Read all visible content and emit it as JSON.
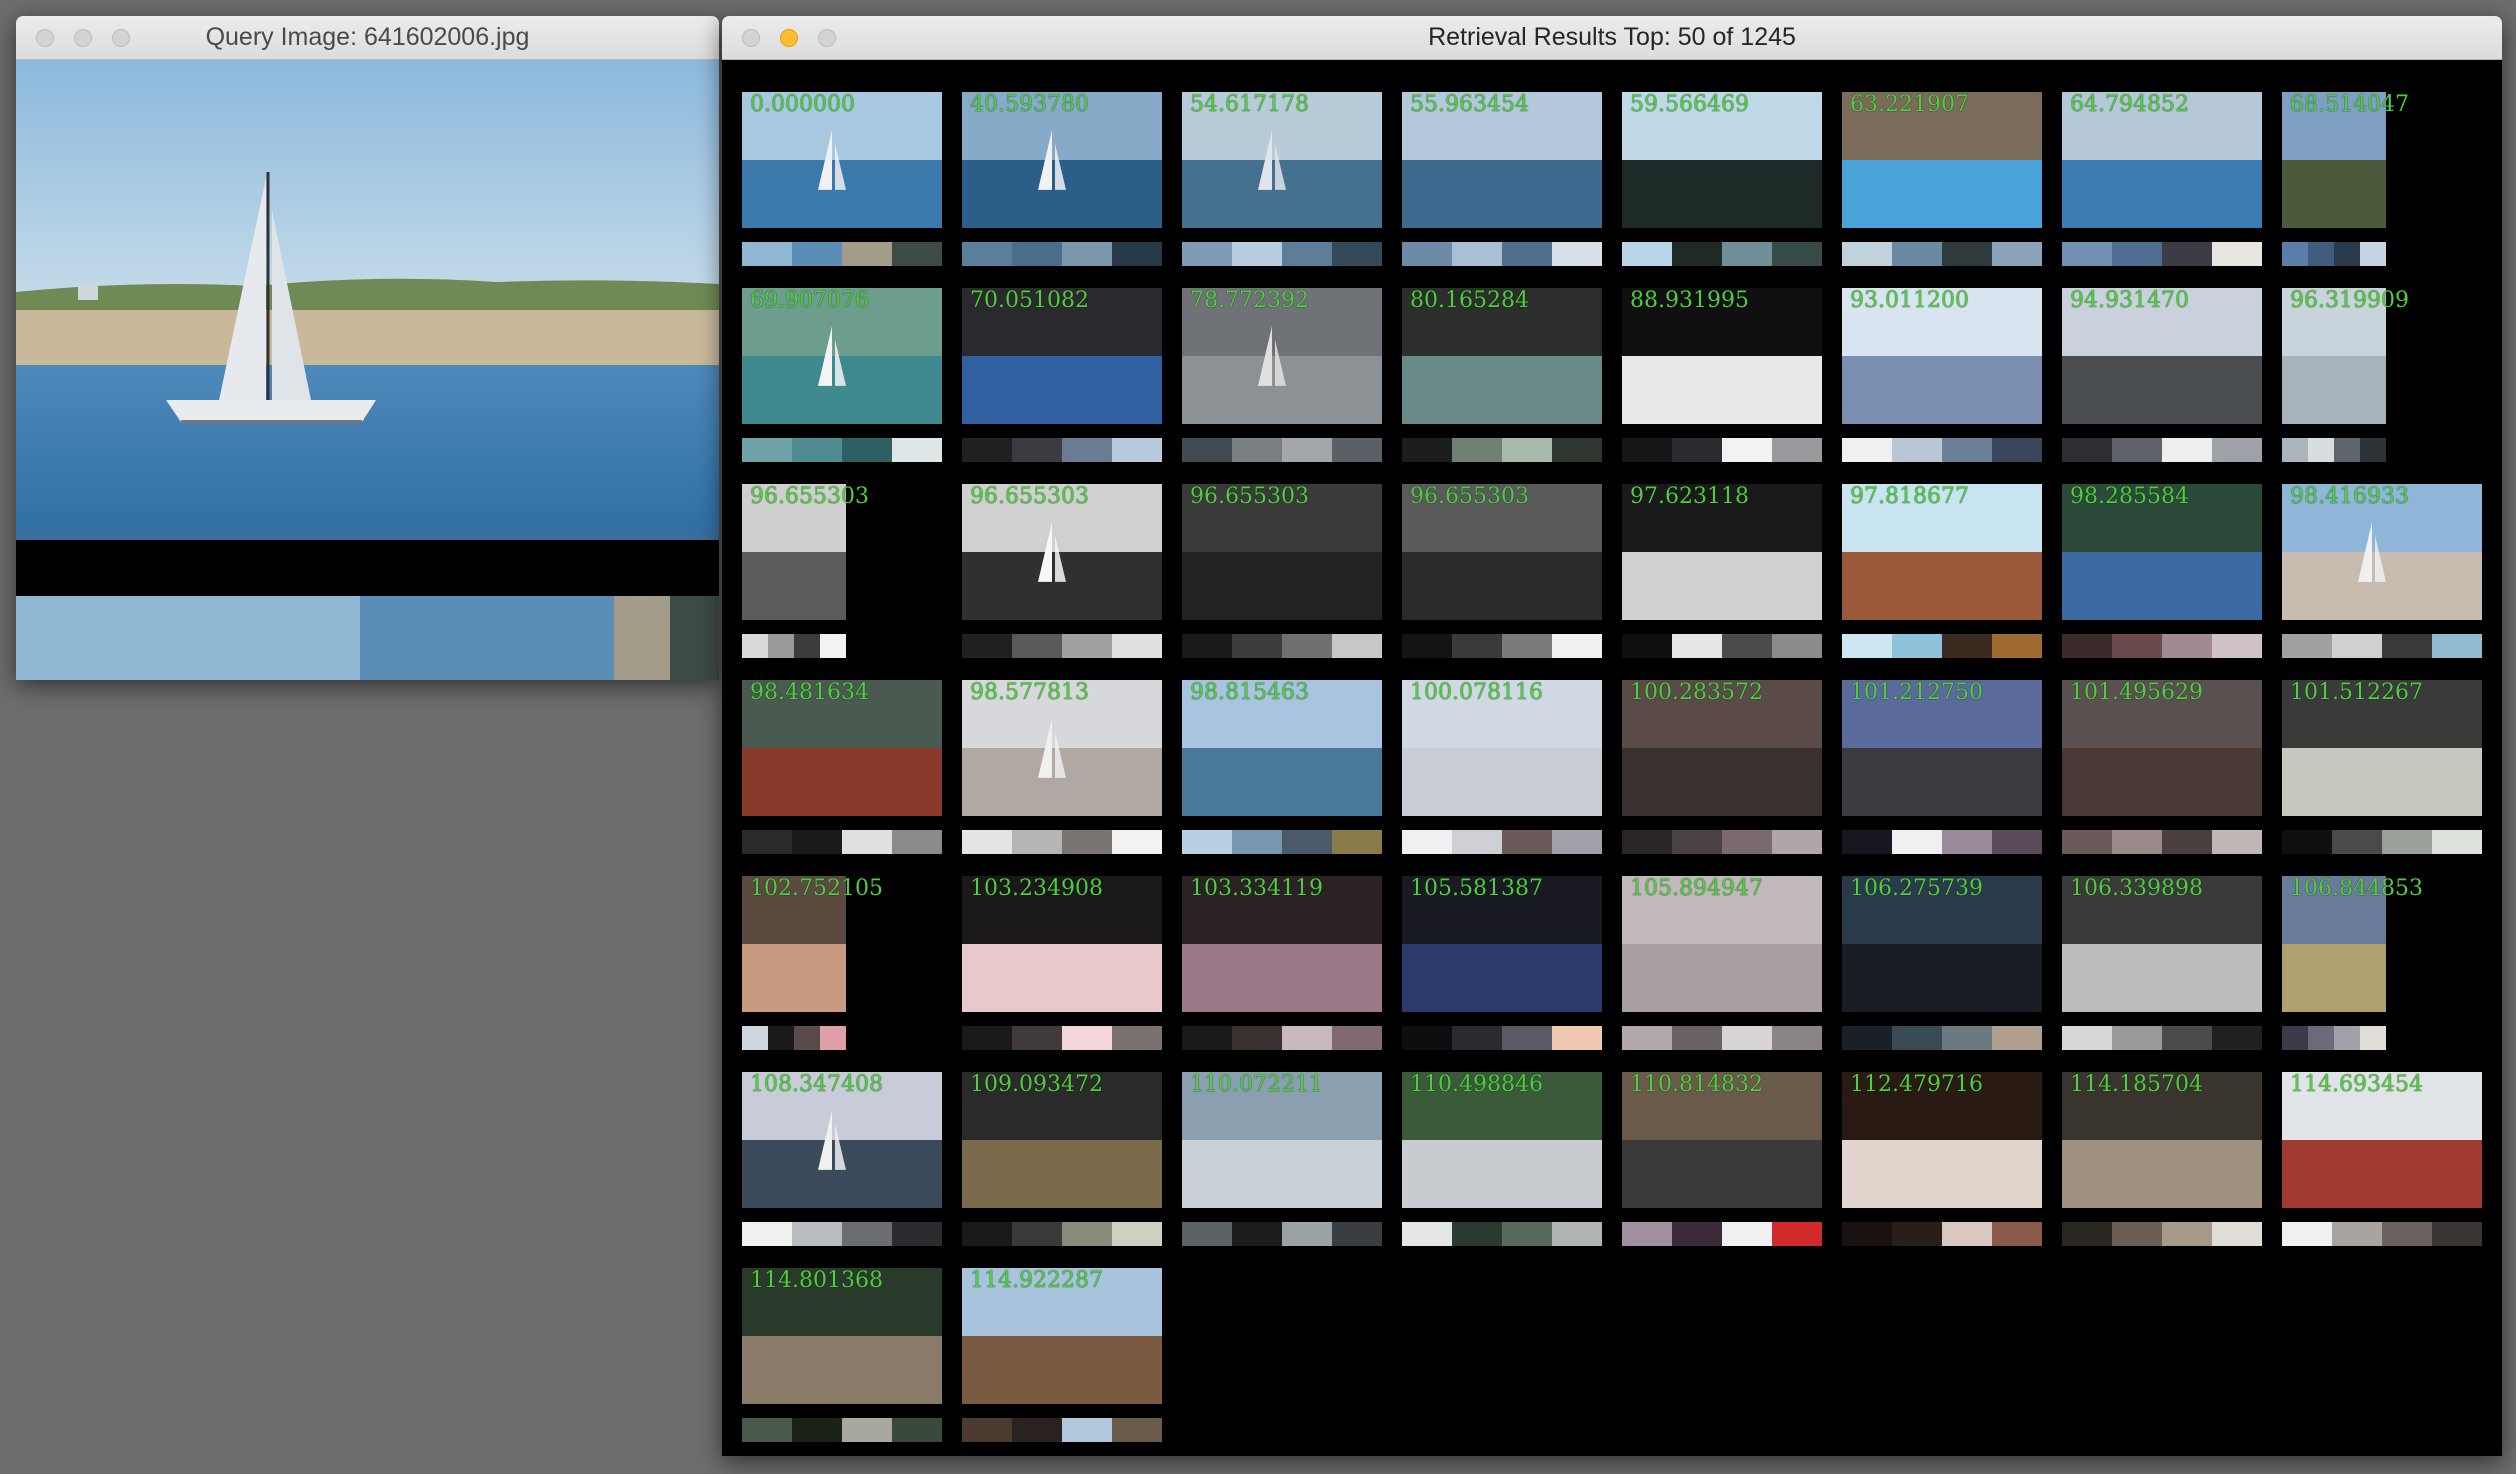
{
  "query_window": {
    "title": "Query Image: 641602006.jpg",
    "swatches": [
      [
        "#8fb6d3",
        49
      ],
      [
        "#5b8eb6",
        36
      ],
      [
        "#a39c88",
        8
      ],
      [
        "#3d4b45",
        7
      ]
    ]
  },
  "results_window": {
    "title": "Retrieval Results Top: 50 of 1245",
    "results": [
      {
        "score": "0.000000",
        "sw": [
          "#8fb6d3",
          "#5b8eb6",
          "#a39c88",
          "#3d4b45"
        ],
        "img": {
          "sky": "#a7c8e0",
          "ground": "#3c79ab",
          "sail": "#eef0f2"
        }
      },
      {
        "score": "40.593780",
        "sw": [
          "#5c7f9c",
          "#4a6d8a",
          "#7a96aa",
          "#273846"
        ],
        "img": {
          "sky": "#87aac8",
          "ground": "#2b5f8a",
          "sail": "#f2f2f2"
        }
      },
      {
        "score": "54.617178",
        "sw": [
          "#7e9cb5",
          "#b9cde0",
          "#5c7e99",
          "#34495a"
        ],
        "img": {
          "sky": "#b7cbd8",
          "ground": "#45708f",
          "sail": "#dfe5ea"
        }
      },
      {
        "score": "55.963454",
        "sw": [
          "#6d8aa6",
          "#a9c0d4",
          "#4f6f8c",
          "#d6e0e8"
        ],
        "img": {
          "sky": "#b3c9db",
          "ground": "#3e6a8f",
          "sail": null
        }
      },
      {
        "score": "59.566469",
        "sw": [
          "#b8d4e6",
          "#1f2a24",
          "#6f8f98",
          "#384b48"
        ],
        "img": {
          "sky": "#c1d8e8",
          "ground": "#1d2a28",
          "sail": null
        }
      },
      {
        "score": "63.221907",
        "sw": [
          "#c2d2dc",
          "#6a8aa3",
          "#2f3a3d",
          "#8aa3b8"
        ],
        "img": {
          "sky": "#7a6b5a",
          "ground": "#4aa3d8",
          "sail": null
        }
      },
      {
        "score": "64.794852",
        "sw": [
          "#6f8fb3",
          "#4d6d91",
          "#3c3c46",
          "#e8e4e0"
        ],
        "img": {
          "sky": "#b6c8d8",
          "ground": "#3b7cb4",
          "sail": null
        }
      },
      {
        "score": "68.514047",
        "sw": [
          "#5a7ea8",
          "#405d80",
          "#2a3a4c",
          "#c5d4e1"
        ],
        "img": {
          "sky": "#7f9fc2",
          "ground": "#4a5a3a",
          "sail": null
        }
      },
      {
        "score": "69.907076",
        "sw": [
          "#6fa3a8",
          "#4f8a90",
          "#2e5f63",
          "#dfe6e8"
        ],
        "img": {
          "sky": "#6d9d8c",
          "ground": "#3e8a8f",
          "sail": "#f4f4f4"
        }
      },
      {
        "score": "70.051082",
        "sw": [
          "#1e2022",
          "#3a3c42",
          "#6b7c92",
          "#b8cade"
        ],
        "img": {
          "sky": "#2a2a2e",
          "ground": "#3060a0",
          "sail": null
        }
      },
      {
        "score": "78.772392",
        "sw": [
          "#3f4a52",
          "#7a7f84",
          "#a3a7aa",
          "#5a6066"
        ],
        "img": {
          "sky": "#6f7377",
          "ground": "#8c9195",
          "sail": "#e0e0e0"
        }
      },
      {
        "score": "80.165284",
        "sw": [
          "#1c1e1c",
          "#6f7f72",
          "#a8b8ab",
          "#2f3630"
        ],
        "img": {
          "sky": "#2b2e2a",
          "ground": "#6a8a88",
          "sail": null
        }
      },
      {
        "score": "88.931995",
        "sw": [
          "#151618",
          "#2a2c30",
          "#f2f2f2",
          "#9a9a9e"
        ],
        "img": {
          "sky": "#101010",
          "ground": "#e8e8e8",
          "sail": null
        }
      },
      {
        "score": "93.011200",
        "sw": [
          "#f0f0f0",
          "#b9c6d4",
          "#6b7f96",
          "#39455a"
        ],
        "img": {
          "sky": "#d8e4f0",
          "ground": "#7a8fb0",
          "sail": null
        }
      },
      {
        "score": "94.931470",
        "sw": [
          "#2d2f33",
          "#5f6268",
          "#eeeeee",
          "#9ea2a8"
        ],
        "img": {
          "sky": "#c9d2dc",
          "ground": "#4a4d50",
          "sail": null
        }
      },
      {
        "score": "96.319909",
        "sw": [
          "#aab4bb",
          "#d7dde1",
          "#5d666c",
          "#2c3236"
        ],
        "img": {
          "sky": "#c8d3db",
          "ground": "#a7b3bb",
          "sail": null
        }
      },
      {
        "score": "96.655303",
        "sw": [
          "#d9d9d9",
          "#9a9a9a",
          "#3b3b3b",
          "#f2f2f2"
        ],
        "img": {
          "sky": "#cfcfcf",
          "ground": "#5b5b5b",
          "sail": null
        }
      },
      {
        "score": "96.655303",
        "sw": [
          "#202020",
          "#5a5a5a",
          "#a0a0a0",
          "#e0e0e0"
        ],
        "img": {
          "sky": "#d0d0d0",
          "ground": "#303030",
          "sail": "#f8f8f8"
        }
      },
      {
        "score": "96.655303",
        "sw": [
          "#1a1a1a",
          "#3d3d3d",
          "#707070",
          "#c8c8c8"
        ],
        "img": {
          "sky": "#3a3a3a",
          "ground": "#222222",
          "sail": null
        }
      },
      {
        "score": "96.655303",
        "sw": [
          "#141414",
          "#3a3a3a",
          "#7a7a7a",
          "#f0f0f0"
        ],
        "img": {
          "sky": "#5a5a5a",
          "ground": "#2a2a2a",
          "sail": null
        }
      },
      {
        "score": "97.623118",
        "sw": [
          "#101010",
          "#e6e6e6",
          "#4a4a4a",
          "#8a8a8a"
        ],
        "img": {
          "sky": "#1a1a1a",
          "ground": "#d0d0d0",
          "sail": null
        }
      },
      {
        "score": "97.818677",
        "sw": [
          "#cde6f2",
          "#8fc3dc",
          "#3a2a20",
          "#a06a30"
        ],
        "img": {
          "sky": "#c8e4f0",
          "ground": "#9a5a3a",
          "sail": null
        }
      },
      {
        "score": "98.285584",
        "sw": [
          "#3a2a2a",
          "#6a4a4a",
          "#a08a90",
          "#d0c0c8"
        ],
        "img": {
          "sky": "#2c4a3a",
          "ground": "#3a6aa0",
          "sail": null
        }
      },
      {
        "score": "98.416933",
        "sw": [
          "#a0a0a0",
          "#d0d0d0",
          "#3a3a3a",
          "#8fbad0"
        ],
        "img": {
          "sky": "#8fb6d8",
          "ground": "#c8bcb0",
          "sail": "#f0f0f0"
        }
      },
      {
        "score": "98.481634",
        "sw": [
          "#2a2a2a",
          "#1a1a1a",
          "#e0e0e0",
          "#8a8a8a"
        ],
        "img": {
          "sky": "#4a5a50",
          "ground": "#8a3a2a",
          "sail": null
        }
      },
      {
        "score": "98.577813",
        "sw": [
          "#e4e4e6",
          "#b6b4b4",
          "#7a7472",
          "#f2f2f2"
        ],
        "img": {
          "sky": "#d6d8dc",
          "ground": "#b0a8a2",
          "sail": "#f0f0f0"
        }
      },
      {
        "score": "98.815463",
        "sw": [
          "#b8d0e4",
          "#7896b0",
          "#4a5a6a",
          "#8a7a4a"
        ],
        "img": {
          "sky": "#a8c4e0",
          "ground": "#4a7a9a",
          "sail": null
        }
      },
      {
        "score": "100.078116",
        "sw": [
          "#f0f0f2",
          "#cfcfd6",
          "#6a5a5a",
          "#a0a0aa"
        ],
        "img": {
          "sky": "#d0d8e4",
          "ground": "#c8ccd4",
          "sail": null
        }
      },
      {
        "score": "100.283572",
        "sw": [
          "#2a2628",
          "#4a4244",
          "#7a6a6e",
          "#b0a6aa"
        ],
        "img": {
          "sky": "#5a4a48",
          "ground": "#3a3030",
          "sail": null
        }
      },
      {
        "score": "101.212750",
        "sw": [
          "#1a1620",
          "#f0f0f2",
          "#9a8a9a",
          "#5a4a5a"
        ],
        "img": {
          "sky": "#5a6a9a",
          "ground": "#3a3a40",
          "sail": null
        }
      },
      {
        "score": "101.495629",
        "sw": [
          "#6a5a5a",
          "#9a8a8a",
          "#4a4040",
          "#c0b6b6"
        ],
        "img": {
          "sky": "#5a5050",
          "ground": "#4a3a36",
          "sail": null
        }
      },
      {
        "score": "101.512267",
        "sw": [
          "#101010",
          "#4a4a4a",
          "#9aa09a",
          "#dde2dd"
        ],
        "img": {
          "sky": "#3a3a3a",
          "ground": "#c8c8c0",
          "sail": null
        }
      },
      {
        "score": "102.752105",
        "sw": [
          "#cfd8e0",
          "#1a1a1a",
          "#5a4a4a",
          "#e0a0a8"
        ],
        "img": {
          "sky": "#5a4a40",
          "ground": "#c89a80",
          "sail": null
        }
      },
      {
        "score": "103.234908",
        "sw": [
          "#1a1818",
          "#403a3a",
          "#f2d6dc",
          "#7a7070"
        ],
        "img": {
          "sky": "#1a1818",
          "ground": "#e8c8c8",
          "sail": null
        }
      },
      {
        "score": "103.334119",
        "sw": [
          "#1a1a1a",
          "#3a3030",
          "#c8b8c0",
          "#806a70"
        ],
        "img": {
          "sky": "#2a2224",
          "ground": "#9a7a88",
          "sail": null
        }
      },
      {
        "score": "105.581387",
        "sw": [
          "#0e0e10",
          "#2a2a30",
          "#5a5a66",
          "#f0c8b0"
        ],
        "img": {
          "sky": "#1a1a22",
          "ground": "#2a3a6a",
          "sail": null
        }
      },
      {
        "score": "105.894947",
        "sw": [
          "#b0a8ac",
          "#6a6266",
          "#d8d4d6",
          "#8a8488"
        ],
        "img": {
          "sky": "#c0b8bc",
          "ground": "#a89ea4",
          "sail": null
        }
      },
      {
        "score": "106.275739",
        "sw": [
          "#1a2028",
          "#3a4a52",
          "#6a7a80",
          "#b0a090"
        ],
        "img": {
          "sky": "#2a3a4a",
          "ground": "#1a1e24",
          "sail": null
        }
      },
      {
        "score": "106.339898",
        "sw": [
          "#d8d8d8",
          "#9a9a9a",
          "#4a4a4a",
          "#202020"
        ],
        "img": {
          "sky": "#3a3a3a",
          "ground": "#bcbcbc",
          "sail": null
        }
      },
      {
        "score": "106.844853",
        "sw": [
          "#3a3a4a",
          "#6a6a7a",
          "#a0a0a8",
          "#e0dcd8"
        ],
        "img": {
          "sky": "#6a7a9a",
          "ground": "#b0a070",
          "sail": null
        }
      },
      {
        "score": "108.347408",
        "sw": [
          "#f0f2f0",
          "#b8bcc0",
          "#6a6e72",
          "#2a2c30"
        ],
        "img": {
          "sky": "#c8ccd8",
          "ground": "#3a4a5a",
          "sail": "#f0f0f0"
        }
      },
      {
        "score": "109.093472",
        "sw": [
          "#1a1a1a",
          "#3a3a3a",
          "#8a8a7a",
          "#d0d0c0"
        ],
        "img": {
          "sky": "#2a2a2a",
          "ground": "#7a6a4a",
          "sail": null
        }
      },
      {
        "score": "110.072211",
        "sw": [
          "#5a6266",
          "#1a1c1e",
          "#9aa2a6",
          "#3a3e40"
        ],
        "img": {
          "sky": "#8aa0b0",
          "ground": "#c8d0d8",
          "sail": null
        }
      },
      {
        "score": "110.498846",
        "sw": [
          "#e4e6e6",
          "#2a3a30",
          "#5a6a5a",
          "#b0b4b4"
        ],
        "img": {
          "sky": "#3a5a3a",
          "ground": "#c8ccd0",
          "sail": null
        }
      },
      {
        "score": "110.814832",
        "sw": [
          "#a090a0",
          "#3a2a3a",
          "#f0f0f2",
          "#d02a2a"
        ],
        "img": {
          "sky": "#6a5a4a",
          "ground": "#3a3a3a",
          "sail": null
        }
      },
      {
        "score": "112.479716",
        "sw": [
          "#1a1210",
          "#2a1e1a",
          "#d8c8c0",
          "#8a5a4a"
        ],
        "img": {
          "sky": "#2a1a14",
          "ground": "#e0d4cc",
          "sail": null
        }
      },
      {
        "score": "114.185704",
        "sw": [
          "#2a2622",
          "#6a5e52",
          "#a89a8a",
          "#e0dcd8"
        ],
        "img": {
          "sky": "#3a342e",
          "ground": "#a09080",
          "sail": null
        }
      },
      {
        "score": "114.693454",
        "sw": [
          "#f0f0f0",
          "#a8a4a0",
          "#6a6260",
          "#3a3432"
        ],
        "img": {
          "sky": "#e0e4e8",
          "ground": "#a03a30",
          "sail": null
        }
      },
      {
        "score": "114.801368",
        "sw": [
          "#4a5a4a",
          "#1a2218",
          "#a8a8a0",
          "#3a4a3a"
        ],
        "img": {
          "sky": "#2a3a2a",
          "ground": "#8a7a6a",
          "sail": null
        }
      },
      {
        "score": "114.922287",
        "sw": [
          "#4a3a30",
          "#2a2220",
          "#b0c8dc",
          "#6a5a4a"
        ],
        "img": {
          "sky": "#a8c4dc",
          "ground": "#7a5a40",
          "sail": null
        }
      }
    ]
  }
}
